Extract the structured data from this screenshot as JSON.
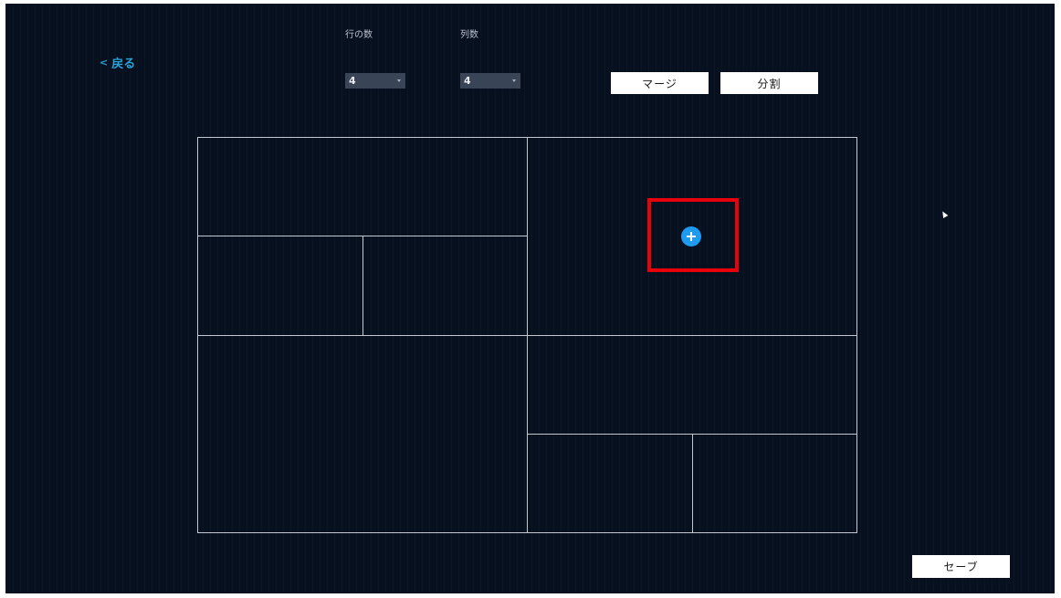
{
  "header": {
    "back_label": "戻る"
  },
  "rows": {
    "label": "行の数",
    "value": "4"
  },
  "columns": {
    "label": "列数",
    "value": "4"
  },
  "toolbar": {
    "merge_label": "マージ",
    "split_label": "分割"
  },
  "footer": {
    "save_label": "セーブ"
  },
  "colors": {
    "background": "#07101f",
    "accent": "#1e9aee",
    "highlight": "#e8000b"
  },
  "icons": {
    "add": "plus-circle-icon",
    "back": "chevron-left-icon"
  }
}
